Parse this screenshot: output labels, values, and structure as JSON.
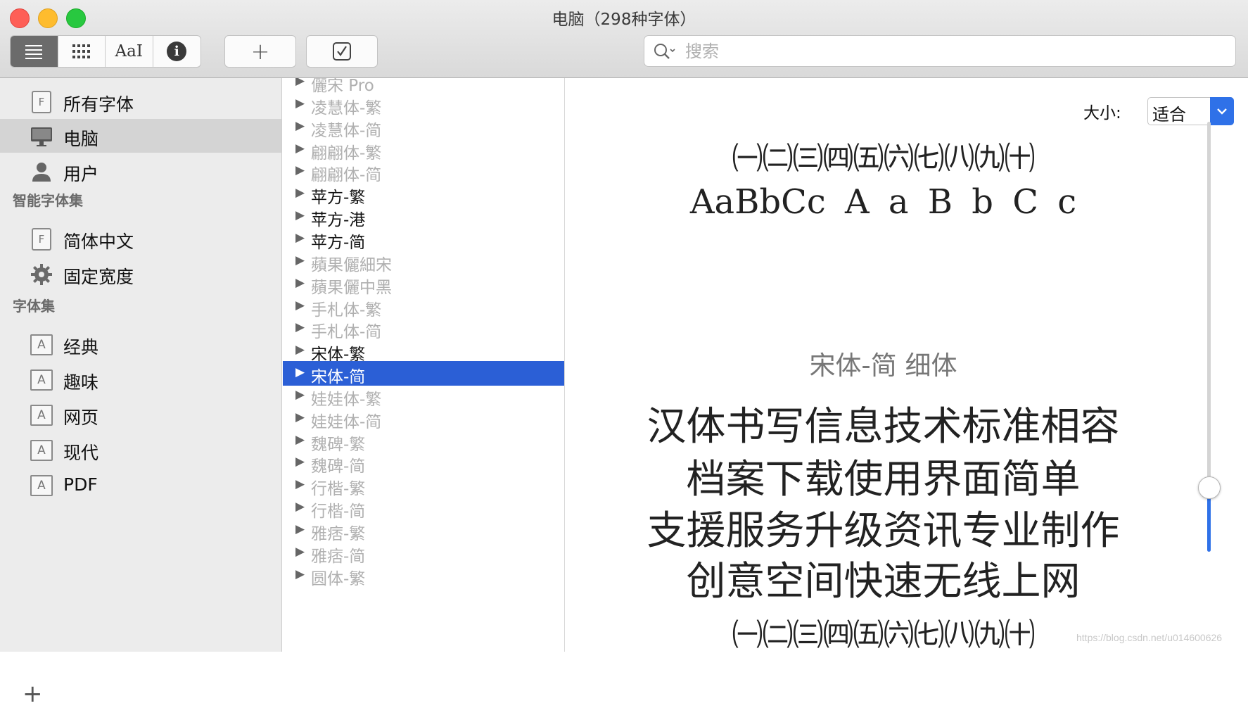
{
  "window": {
    "title": "电脑（298种字体）"
  },
  "toolbar": {
    "view_buttons": [
      {
        "icon": "list-view-icon"
      },
      {
        "icon": "grid-view-icon"
      },
      {
        "icon": "sample-text-icon",
        "label": "AaI"
      },
      {
        "icon": "info-icon",
        "label": "i"
      }
    ],
    "add_label": "+",
    "validate_icon": "checkbox-icon",
    "search": {
      "placeholder": "搜索",
      "value": ""
    }
  },
  "sidebar": {
    "libraries": [
      {
        "label": "所有字体",
        "icon": "font-library-icon"
      },
      {
        "label": "电脑",
        "icon": "computer-icon",
        "selected": true
      },
      {
        "label": "用户",
        "icon": "user-icon"
      }
    ],
    "smart_heading": "智能字体集",
    "smart": [
      {
        "label": "简体中文",
        "icon": "font-library-icon"
      },
      {
        "label": "固定宽度",
        "icon": "gear-icon"
      }
    ],
    "collections_heading": "字体集",
    "collections": [
      {
        "label": "经典",
        "icon": "collection-icon"
      },
      {
        "label": "趣味",
        "icon": "collection-icon"
      },
      {
        "label": "网页",
        "icon": "collection-icon"
      },
      {
        "label": "现代",
        "icon": "collection-icon"
      },
      {
        "label": "PDF",
        "icon": "collection-icon"
      }
    ],
    "add_label": "+",
    "f_letter": "F",
    "a_letter": "A"
  },
  "fonts": [
    {
      "name": "儷宋 Pro",
      "state": "dim"
    },
    {
      "name": "凌慧体-繁",
      "state": "dim"
    },
    {
      "name": "凌慧体-简",
      "state": "dim"
    },
    {
      "name": "翩翩体-繁",
      "state": "dim"
    },
    {
      "name": "翩翩体-简",
      "state": "dim"
    },
    {
      "name": "苹方-繁",
      "state": "on"
    },
    {
      "name": "苹方-港",
      "state": "on"
    },
    {
      "name": "苹方-简",
      "state": "on"
    },
    {
      "name": "蘋果儷細宋",
      "state": "dim"
    },
    {
      "name": "蘋果儷中黑",
      "state": "dim"
    },
    {
      "name": "手札体-繁",
      "state": "dim"
    },
    {
      "name": "手札体-简",
      "state": "dim"
    },
    {
      "name": "宋体-繁",
      "state": "on"
    },
    {
      "name": "宋体-简",
      "state": "selected"
    },
    {
      "name": "娃娃体-繁",
      "state": "dim"
    },
    {
      "name": "娃娃体-简",
      "state": "dim"
    },
    {
      "name": "魏碑-繁",
      "state": "dim"
    },
    {
      "name": "魏碑-简",
      "state": "dim"
    },
    {
      "name": "行楷-繁",
      "state": "dim"
    },
    {
      "name": "行楷-简",
      "state": "dim"
    },
    {
      "name": "雅痞-繁",
      "state": "dim"
    },
    {
      "name": "雅痞-简",
      "state": "dim"
    },
    {
      "name": "圆体-繁",
      "state": "dim"
    }
  ],
  "preview": {
    "size_label": "大小:",
    "size_value": "适合",
    "numbers": "㈠㈡㈢㈣㈤㈥㈦㈧㈨㈩",
    "latin": "AaBbCc A a B b C c",
    "font_name": "宋体-简 细体",
    "lines": [
      "汉体书写信息技术标准相容",
      "档案下载使用界面简单",
      "支援服务升级资讯专业制作",
      "创意空间快速无线上网"
    ],
    "numbers_bottom": "㈠㈡㈢㈣㈤㈥㈦㈧㈨㈩",
    "zoom_level": 0.15,
    "accent_color": "#2f71e8"
  },
  "watermark": "https://blog.csdn.net/u014600626"
}
